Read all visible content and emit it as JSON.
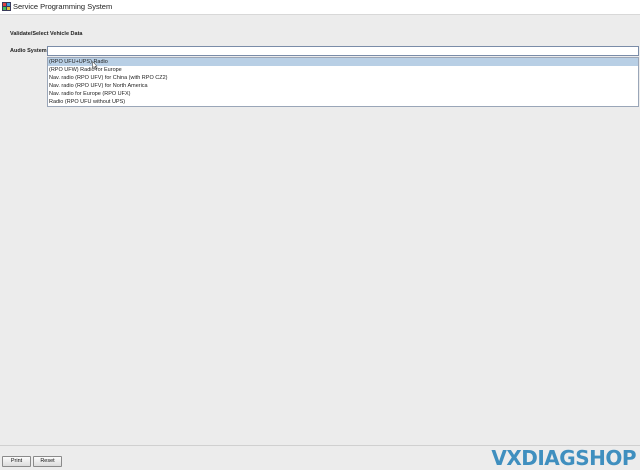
{
  "window": {
    "title": "Service Programming System"
  },
  "page": {
    "section_title": "Validate/Select Vehicle Data"
  },
  "audio_system": {
    "label": "Audio System",
    "value": "",
    "options": [
      "(RPO UFU+UPS) Radio",
      "(RPO UFW) Radio for Europe",
      "Nav. radio (RPO UFV) for China (with RPO CZ2)",
      "Nav. radio (RPO UFV) for North America",
      "Nav. radio for Europe (RPO UFX)",
      "Radio (RPO UFU without UPS)"
    ],
    "highlighted_index": 0
  },
  "buttons": {
    "print": "Print",
    "reset": "Reset"
  },
  "watermark": "VXDIAGSHOP",
  "colors": {
    "selection": "#b8cfe5",
    "watermark": "#3f8fbf"
  }
}
